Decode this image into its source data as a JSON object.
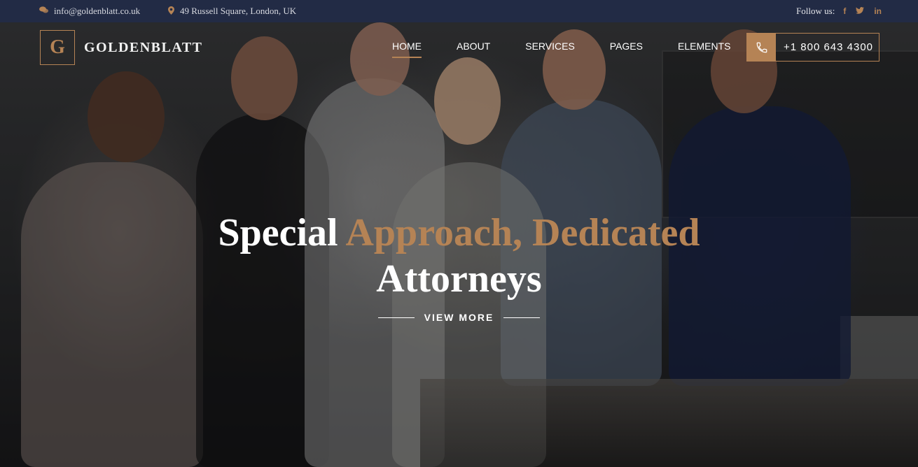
{
  "topbar": {
    "email": "info@goldenblatt.co.uk",
    "address": "49 Russell Square, London, UK",
    "follow_label": "Follow us:",
    "social": [
      {
        "icon": "facebook-icon",
        "glyph": "f"
      },
      {
        "icon": "twitter-icon",
        "glyph": "🐦"
      },
      {
        "icon": "linkedin-icon",
        "glyph": "in"
      }
    ]
  },
  "header": {
    "logo_letter": "G",
    "logo_text": "GOLDENBLATT",
    "nav": [
      {
        "label": "HOME",
        "active": true
      },
      {
        "label": "ABOUT",
        "active": false
      },
      {
        "label": "SERVICES",
        "active": false
      },
      {
        "label": "PAGES",
        "active": false
      },
      {
        "label": "ELEMENTS",
        "active": false
      }
    ],
    "phone": "+1 800 643 4300"
  },
  "hero": {
    "headline_part1": "Special ",
    "headline_accent": "Approach, Dedicated",
    "headline_part2": "Attorneys",
    "cta_label": "VIEW MORE"
  },
  "colors": {
    "accent": "#b58355",
    "topbar_bg": "#222b45"
  }
}
